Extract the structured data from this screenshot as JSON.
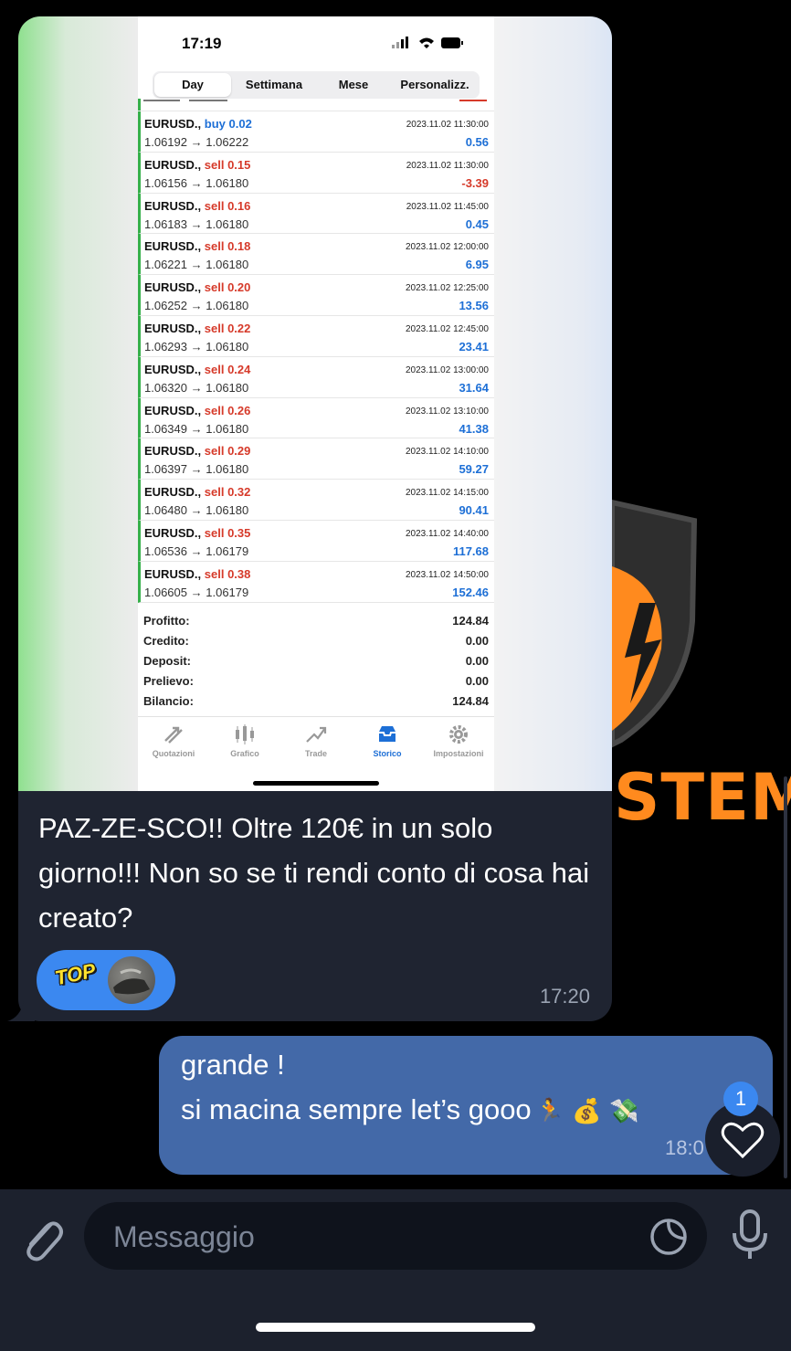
{
  "background": {
    "brand_word_visible": "STEM",
    "accent_color": "#ff8a1e"
  },
  "incoming_message": {
    "screenshot": {
      "status_time": "17:19",
      "segments": [
        "Day",
        "Settimana",
        "Mese",
        "Personalizz."
      ],
      "active_segment": "Day",
      "trades": [
        {
          "symbol": "EURUSD.,",
          "side": "buy",
          "lot": "0.02",
          "open": "1.06192",
          "close": "1.06222",
          "time": "2023.11.02 11:30:00",
          "profit": "0.56"
        },
        {
          "symbol": "EURUSD.,",
          "side": "sell",
          "lot": "0.15",
          "open": "1.06156",
          "close": "1.06180",
          "time": "2023.11.02 11:30:00",
          "profit": "-3.39"
        },
        {
          "symbol": "EURUSD.,",
          "side": "sell",
          "lot": "0.16",
          "open": "1.06183",
          "close": "1.06180",
          "time": "2023.11.02 11:45:00",
          "profit": "0.45"
        },
        {
          "symbol": "EURUSD.,",
          "side": "sell",
          "lot": "0.18",
          "open": "1.06221",
          "close": "1.06180",
          "time": "2023.11.02 12:00:00",
          "profit": "6.95"
        },
        {
          "symbol": "EURUSD.,",
          "side": "sell",
          "lot": "0.20",
          "open": "1.06252",
          "close": "1.06180",
          "time": "2023.11.02 12:25:00",
          "profit": "13.56"
        },
        {
          "symbol": "EURUSD.,",
          "side": "sell",
          "lot": "0.22",
          "open": "1.06293",
          "close": "1.06180",
          "time": "2023.11.02 12:45:00",
          "profit": "23.41"
        },
        {
          "symbol": "EURUSD.,",
          "side": "sell",
          "lot": "0.24",
          "open": "1.06320",
          "close": "1.06180",
          "time": "2023.11.02 13:00:00",
          "profit": "31.64"
        },
        {
          "symbol": "EURUSD.,",
          "side": "sell",
          "lot": "0.26",
          "open": "1.06349",
          "close": "1.06180",
          "time": "2023.11.02 13:10:00",
          "profit": "41.38"
        },
        {
          "symbol": "EURUSD.,",
          "side": "sell",
          "lot": "0.29",
          "open": "1.06397",
          "close": "1.06180",
          "time": "2023.11.02 14:10:00",
          "profit": "59.27"
        },
        {
          "symbol": "EURUSD.,",
          "side": "sell",
          "lot": "0.32",
          "open": "1.06480",
          "close": "1.06180",
          "time": "2023.11.02 14:15:00",
          "profit": "90.41"
        },
        {
          "symbol": "EURUSD.,",
          "side": "sell",
          "lot": "0.35",
          "open": "1.06536",
          "close": "1.06179",
          "time": "2023.11.02 14:40:00",
          "profit": "117.68"
        },
        {
          "symbol": "EURUSD.,",
          "side": "sell",
          "lot": "0.38",
          "open": "1.06605",
          "close": "1.06179",
          "time": "2023.11.02 14:50:00",
          "profit": "152.46"
        }
      ],
      "summary": [
        {
          "label": "Profitto:",
          "value": "124.84"
        },
        {
          "label": "Credito:",
          "value": "0.00"
        },
        {
          "label": "Deposit:",
          "value": "0.00"
        },
        {
          "label": "Prelievo:",
          "value": "0.00"
        },
        {
          "label": "Bilancio:",
          "value": "124.84"
        }
      ],
      "tabs": [
        {
          "label": "Quotazioni",
          "icon": "quotes-arrows-icon"
        },
        {
          "label": "Grafico",
          "icon": "candlestick-chart-icon"
        },
        {
          "label": "Trade",
          "icon": "trade-line-icon"
        },
        {
          "label": "Storico",
          "icon": "history-inbox-icon",
          "active": true
        },
        {
          "label": "Impostazioni",
          "icon": "gear-icon"
        }
      ],
      "colors": {
        "buy": "#1d6fd6",
        "sell": "#d63a2a",
        "active_tab": "#1d6fd6"
      }
    },
    "text": "PAZ-ZE-SCO!! Oltre 120€ in un solo giorno!!! Non so se ti rendi conto di cosa hai creato?",
    "reaction_sticker": "TOP",
    "time": "17:20"
  },
  "outgoing_message": {
    "line1": "grande !",
    "line2": "si macina sempre let’s gooo",
    "emojis": "🏃 💰 💸",
    "time": "18:0",
    "badge_count": "1"
  },
  "composer": {
    "placeholder": "Messaggio"
  }
}
